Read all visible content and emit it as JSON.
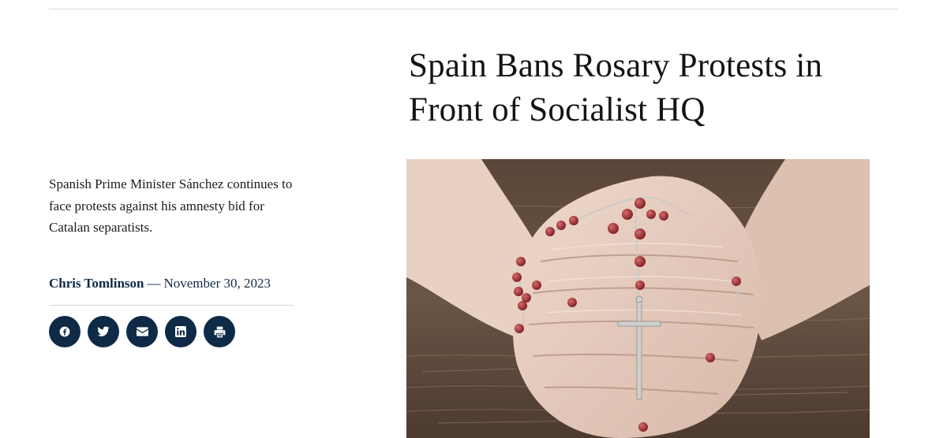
{
  "article": {
    "title": "Spain Bans Rosary Protests in Front of Socialist HQ",
    "dek": "Spanish Prime Minister Sánchez continues to face protests against his amnesty bid for Catalan separatists.",
    "author": "Chris Tomlinson",
    "byline_separator": "—",
    "date": "November 30, 2023"
  },
  "share": {
    "buttons": [
      {
        "icon": "facebook-icon"
      },
      {
        "icon": "twitter-icon"
      },
      {
        "icon": "email-icon"
      },
      {
        "icon": "linkedin-icon"
      },
      {
        "icon": "print-icon"
      }
    ]
  },
  "colors": {
    "accent": "#0e2a47",
    "rule": "#dcdcdc",
    "text": "#1c1c1c"
  }
}
